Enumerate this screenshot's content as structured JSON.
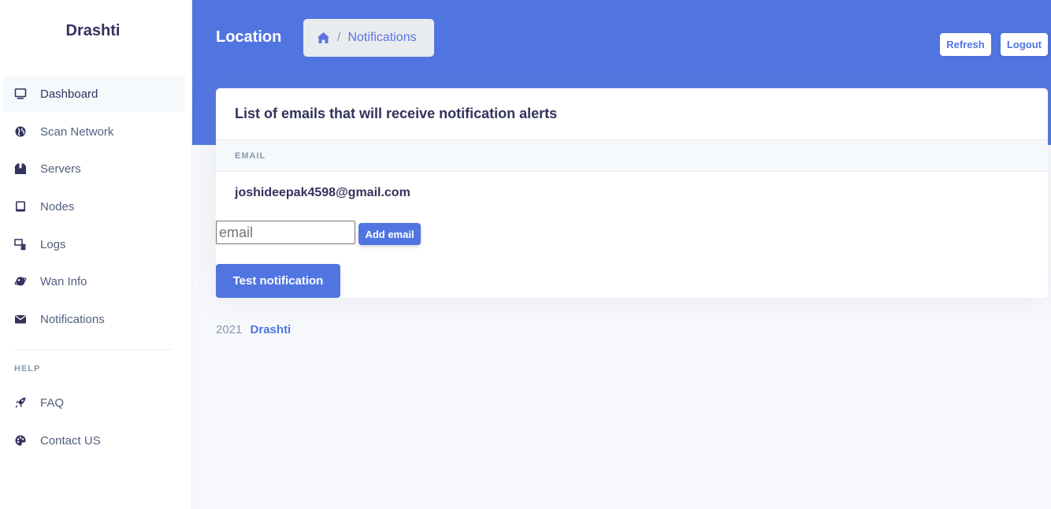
{
  "sidebar": {
    "brand": "Drashti",
    "items": [
      {
        "label": "Dashboard",
        "icon": "monitor-icon",
        "active": true
      },
      {
        "label": "Scan Network",
        "icon": "globe-icon"
      },
      {
        "label": "Servers",
        "icon": "box-icon"
      },
      {
        "label": "Nodes",
        "icon": "tablet-icon"
      },
      {
        "label": "Logs",
        "icon": "logs-icon"
      },
      {
        "label": "Wan Info",
        "icon": "planet-icon"
      },
      {
        "label": "Notifications",
        "icon": "envelope-icon"
      }
    ],
    "help_heading": "HELP",
    "help_items": [
      {
        "label": "FAQ",
        "icon": "rocket-icon"
      },
      {
        "label": "Contact US",
        "icon": "palette-icon"
      }
    ]
  },
  "header": {
    "title": "Location",
    "breadcrumb": {
      "separator": "/",
      "current": "Notifications",
      "icon": "home-icon"
    },
    "refresh_label": "Refresh",
    "logout_label": "Logout"
  },
  "card": {
    "title": "List of emails that will receive notification alerts",
    "column_header": "EMAIL",
    "emails": [
      "joshideepak4598@gmail.com"
    ],
    "email_input": {
      "placeholder": "email",
      "value": ""
    },
    "add_label": "Add email",
    "test_label": "Test notification"
  },
  "footer": {
    "year": "2021",
    "link": "Drashti"
  },
  "colors": {
    "accent": "#5175e0",
    "sidebar_bg": "#ffffff",
    "page_bg": "#f7f8fc"
  }
}
